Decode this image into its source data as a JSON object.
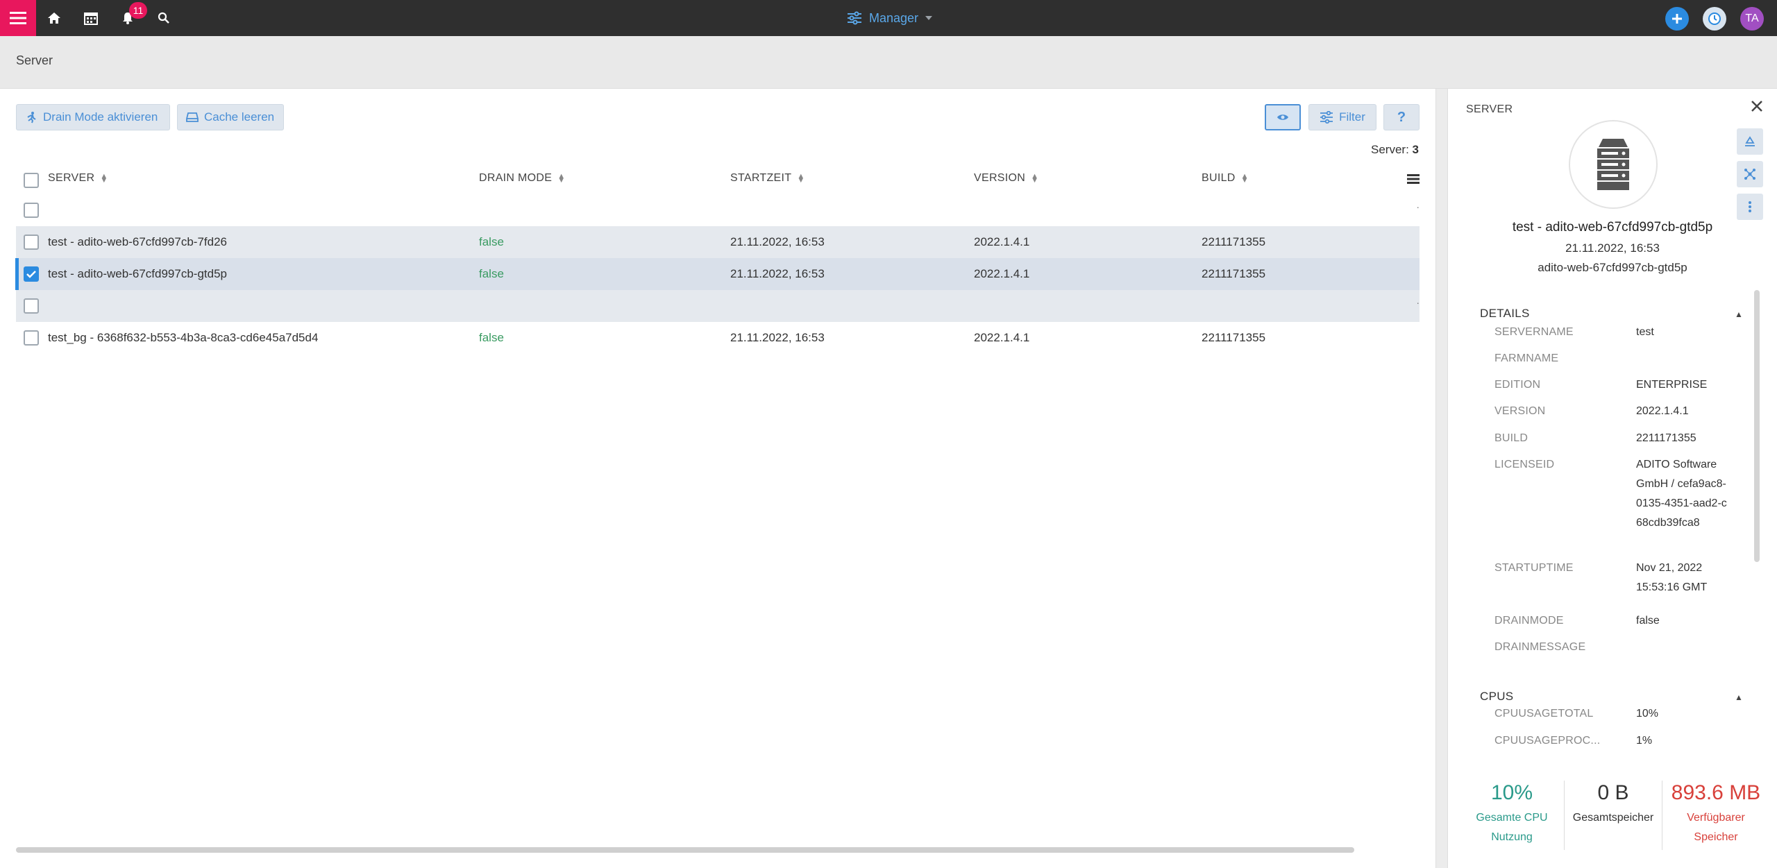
{
  "topbar": {
    "notification_count": "11",
    "module_label": "Manager",
    "avatar_initials": "TA"
  },
  "page": {
    "title": "Server"
  },
  "toolbar": {
    "drain_mode_label": "Drain Mode aktivieren",
    "clear_cache_label": "Cache leeren",
    "filter_label": "Filter",
    "help_label": "?"
  },
  "table": {
    "count_label": "Server:",
    "count_value": "3",
    "columns": [
      "SERVER",
      "DRAIN MODE",
      "STARTZEIT",
      "VERSION",
      "BUILD"
    ],
    "rows": [
      {
        "server": "test - adito-web-67cfd997cb-7fd26",
        "drain": "false",
        "start": "21.11.2022, 16:53",
        "version": "2022.1.4.1",
        "build": "2211171355"
      },
      {
        "server": "test - adito-web-67cfd997cb-gtd5p",
        "drain": "false",
        "start": "21.11.2022, 16:53",
        "version": "2022.1.4.1",
        "build": "2211171355"
      },
      {
        "server": "test_bg - 6368f632-b553-4b3a-8ca3-cd6e45a7d5d4",
        "drain": "false",
        "start": "21.11.2022, 16:53",
        "version": "2022.1.4.1",
        "build": "2211171355"
      }
    ]
  },
  "panel": {
    "title": "SERVER",
    "name": "test - adito-web-67cfd997cb-gtd5p",
    "date": "21.11.2022, 16:53",
    "host": "adito-web-67cfd997cb-gtd5p",
    "details_title": "DETAILS",
    "details": [
      {
        "key": "SERVERNAME",
        "value": "test"
      },
      {
        "key": "FARMNAME",
        "value": ""
      },
      {
        "key": "EDITION",
        "value": "ENTERPRISE"
      },
      {
        "key": "VERSION",
        "value": "2022.1.4.1"
      },
      {
        "key": "BUILD",
        "value": "2211171355"
      },
      {
        "key": "LICENSEID",
        "value": "ADITO Software GmbH / cefa9ac8-0135-4351-aad2-c68cdb39fca8"
      },
      {
        "key": "STARTUPTIME",
        "value": "Nov 21, 2022 15:53:16 GMT"
      },
      {
        "key": "DRAINMODE",
        "value": "false"
      },
      {
        "key": "DRAINMESSAGE",
        "value": ""
      }
    ],
    "cpus_title": "CPUS",
    "cpus": [
      {
        "key": "CPUUSAGETOTAL",
        "value": "10%"
      },
      {
        "key": "CPUUSAGEPROC...",
        "value": "1%"
      }
    ],
    "stats": [
      {
        "value": "10%",
        "label": "Gesamte CPU Nutzung"
      },
      {
        "value": "0 B",
        "label": "Gesamtspeicher"
      },
      {
        "value": "893.6 MB",
        "label": "Verfügbarer Speicher"
      }
    ]
  }
}
